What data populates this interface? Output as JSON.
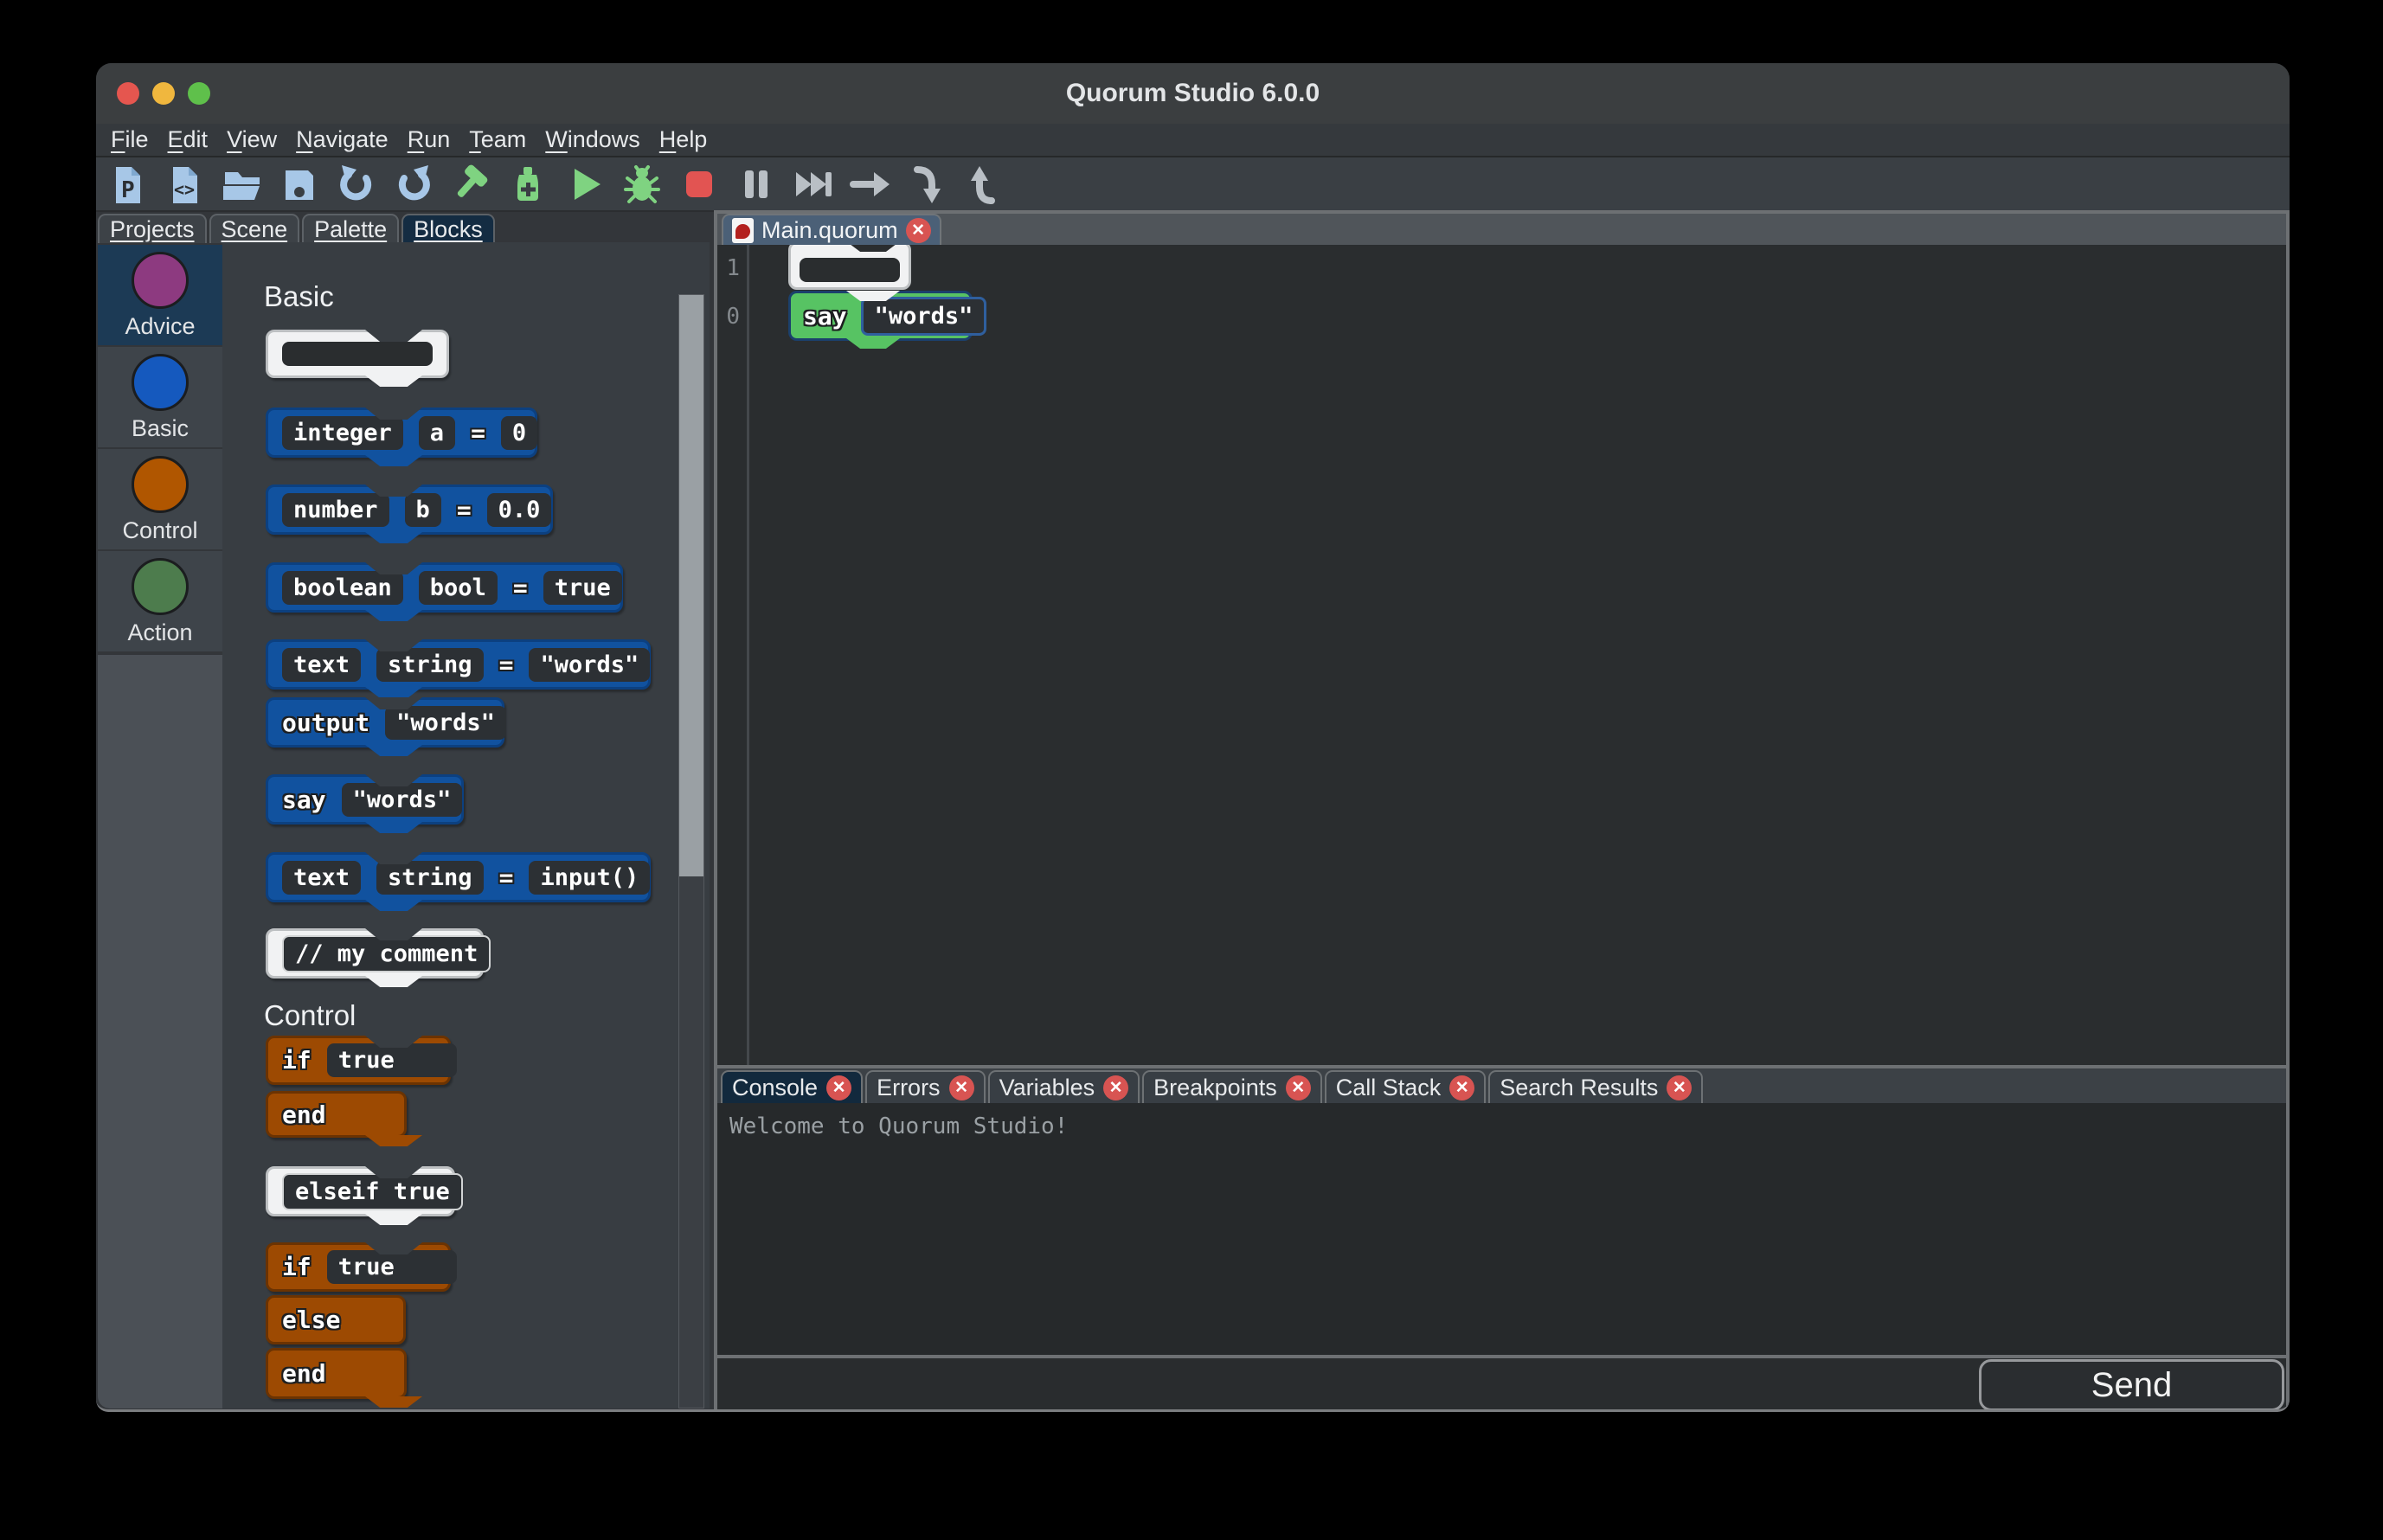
{
  "window": {
    "title": "Quorum Studio 6.0.0"
  },
  "menu": {
    "items": [
      {
        "m": "F",
        "r": "ile"
      },
      {
        "m": "E",
        "r": "dit"
      },
      {
        "m": "V",
        "r": "iew"
      },
      {
        "m": "N",
        "r": "avigate"
      },
      {
        "m": "R",
        "r": "un"
      },
      {
        "m": "T",
        "r": "eam"
      },
      {
        "m": "W",
        "r": "indows"
      },
      {
        "m": "H",
        "r": "elp"
      }
    ]
  },
  "toolbar": {
    "buttons": [
      {
        "name": "new-project",
        "color": "#a7c7e7"
      },
      {
        "name": "new-class",
        "color": "#a7c7e7"
      },
      {
        "name": "open-project",
        "color": "#a7c7e7"
      },
      {
        "name": "save",
        "color": "#a7c7e7"
      },
      {
        "name": "undo",
        "color": "#a7c7e7"
      },
      {
        "name": "redo",
        "color": "#a7c7e7"
      },
      {
        "name": "build",
        "color": "#7fd381"
      },
      {
        "name": "clean-build",
        "color": "#7fd381"
      },
      {
        "name": "run",
        "color": "#7fd381"
      },
      {
        "name": "debug",
        "color": "#7fd381"
      },
      {
        "name": "stop",
        "color": "#e25452"
      },
      {
        "name": "pause",
        "color": "#b9bfc5"
      },
      {
        "name": "continue",
        "color": "#b9bfc5"
      },
      {
        "name": "step-over",
        "color": "#b9bfc5"
      },
      {
        "name": "step-into",
        "color": "#b9bfc5"
      },
      {
        "name": "step-out",
        "color": "#b9bfc5"
      }
    ]
  },
  "left_panel": {
    "tabs": [
      {
        "label": "Projects",
        "selected": false
      },
      {
        "label": "Scene",
        "selected": false
      },
      {
        "label": "Palette",
        "selected": false
      },
      {
        "label": "Blocks",
        "selected": true
      }
    ],
    "categories": [
      {
        "label": "Advice",
        "color": "#8d3a80",
        "selected": true
      },
      {
        "label": "Basic",
        "color": "#1559be",
        "selected": false
      },
      {
        "label": "Control",
        "color": "#b05600",
        "selected": false
      },
      {
        "label": "Action",
        "color": "#4d7c4d",
        "selected": false
      }
    ]
  },
  "palette": {
    "sections": [
      {
        "title": "Basic"
      },
      {
        "title": "Control"
      }
    ],
    "blocks": {
      "integer": {
        "t1": "integer",
        "t2": "a",
        "op": "=",
        "t3": "0"
      },
      "number": {
        "t1": "number",
        "t2": "b",
        "op": "=",
        "t3": "0.0"
      },
      "boolean": {
        "t1": "boolean",
        "t2": "bool",
        "op": "=",
        "t3": "true"
      },
      "text_words": {
        "t1": "text",
        "t2": "string",
        "op": "=",
        "t3": "\"words\""
      },
      "output": {
        "kw": "output",
        "t1": "\"words\""
      },
      "say": {
        "kw": "say",
        "t1": "\"words\""
      },
      "text_input": {
        "t1": "text",
        "t2": "string",
        "op": "=",
        "t3": "input()"
      },
      "comment": {
        "t1": "// my comment"
      },
      "if1": {
        "kw": "if",
        "t1": "true"
      },
      "end1": {
        "kw": "end"
      },
      "elseif": {
        "t1": "elseif true"
      },
      "if2": {
        "kw": "if",
        "t1": "true"
      },
      "else2": {
        "kw": "else"
      },
      "end2": {
        "kw": "end"
      }
    }
  },
  "editor": {
    "tab_label": "Main.quorum",
    "line_numbers": [
      "1",
      "0"
    ],
    "say_block": {
      "kw": "say",
      "t1": "\"words\""
    }
  },
  "console": {
    "tabs": [
      {
        "label": "Console",
        "selected": true
      },
      {
        "label": "Errors",
        "selected": false
      },
      {
        "label": "Variables",
        "selected": false
      },
      {
        "label": "Breakpoints",
        "selected": false
      },
      {
        "label": "Call Stack",
        "selected": false
      },
      {
        "label": "Search Results",
        "selected": false
      }
    ],
    "welcome": "Welcome to Quorum Studio!",
    "send_label": "Send"
  },
  "colors": {
    "block_blue": "#11529f",
    "block_orange": "#9d4a02",
    "block_green": "#57c363",
    "block_white": "#f1f2f3",
    "cat_advice": "#8d3a80",
    "cat_basic": "#1559be",
    "cat_control": "#b05600",
    "cat_action": "#4d7c4d",
    "selected_tab": "#142c42",
    "close_red": "#d85452",
    "titlebar": "#3b3e40",
    "palette_bg": "#383d42",
    "editor_bg": "#2a2d2f",
    "console_bg": "#26292b"
  }
}
